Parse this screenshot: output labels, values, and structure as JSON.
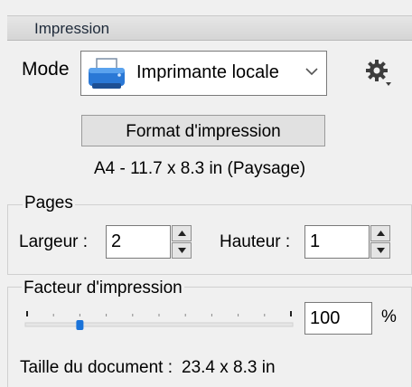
{
  "panel": {
    "title": "Impression"
  },
  "mode": {
    "label": "Mode",
    "selected": "Imprimante locale",
    "icons": {
      "printer": "printer-icon",
      "dropdown": "chevron-down-icon",
      "settings": "gear-icon"
    }
  },
  "format": {
    "button_label": "Format d'impression",
    "info": "A4 - 11.7 x 8.3 in (Paysage)"
  },
  "pages": {
    "title": "Pages",
    "width_label": "Largeur :",
    "width_value": "2",
    "height_label": "Hauteur :",
    "height_value": "1"
  },
  "factor": {
    "title": "Facteur d'impression",
    "value": "100",
    "unit": "%",
    "slider_level": 0.2,
    "doc_size_label": "Taille du document :",
    "doc_size_value": "23.4 x 8.3 in"
  },
  "colors": {
    "accent": "#1a73d9",
    "header_bg": "#dcdcdc",
    "panel_bg": "#f0f0f0"
  }
}
